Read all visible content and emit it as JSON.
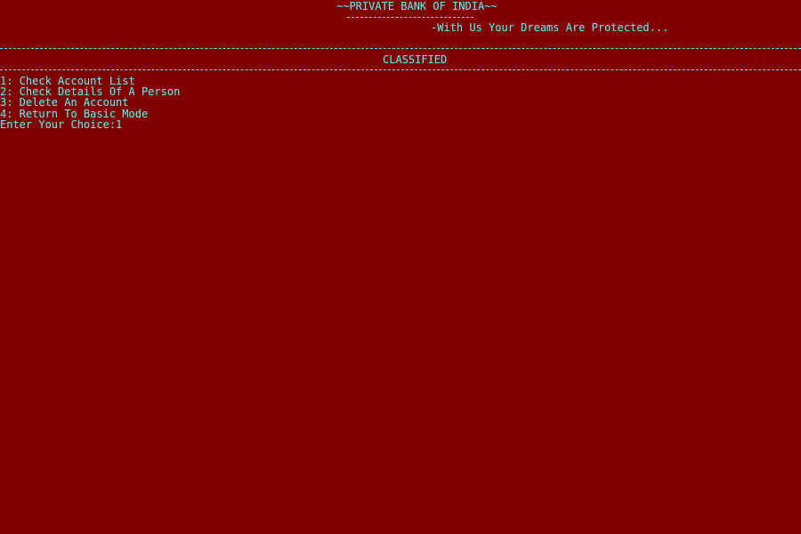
{
  "header": {
    "bank_title": "~~PRIVATE BANK OF INDIA~~",
    "tagline": "-With Us Your Dreams Are Protected..."
  },
  "section": {
    "title": "CLASSIFIED"
  },
  "menu": {
    "items": [
      {
        "label": "1: Check Account List"
      },
      {
        "label": "2: Check Details Of A Person"
      },
      {
        "label": "3: Delete An Account"
      },
      {
        "label": "4: Return To Basic Mode"
      }
    ]
  },
  "prompt": {
    "label": "Enter Your Choice:",
    "value": "1"
  },
  "colors": {
    "background": "#800000",
    "text": "#55ffff"
  }
}
